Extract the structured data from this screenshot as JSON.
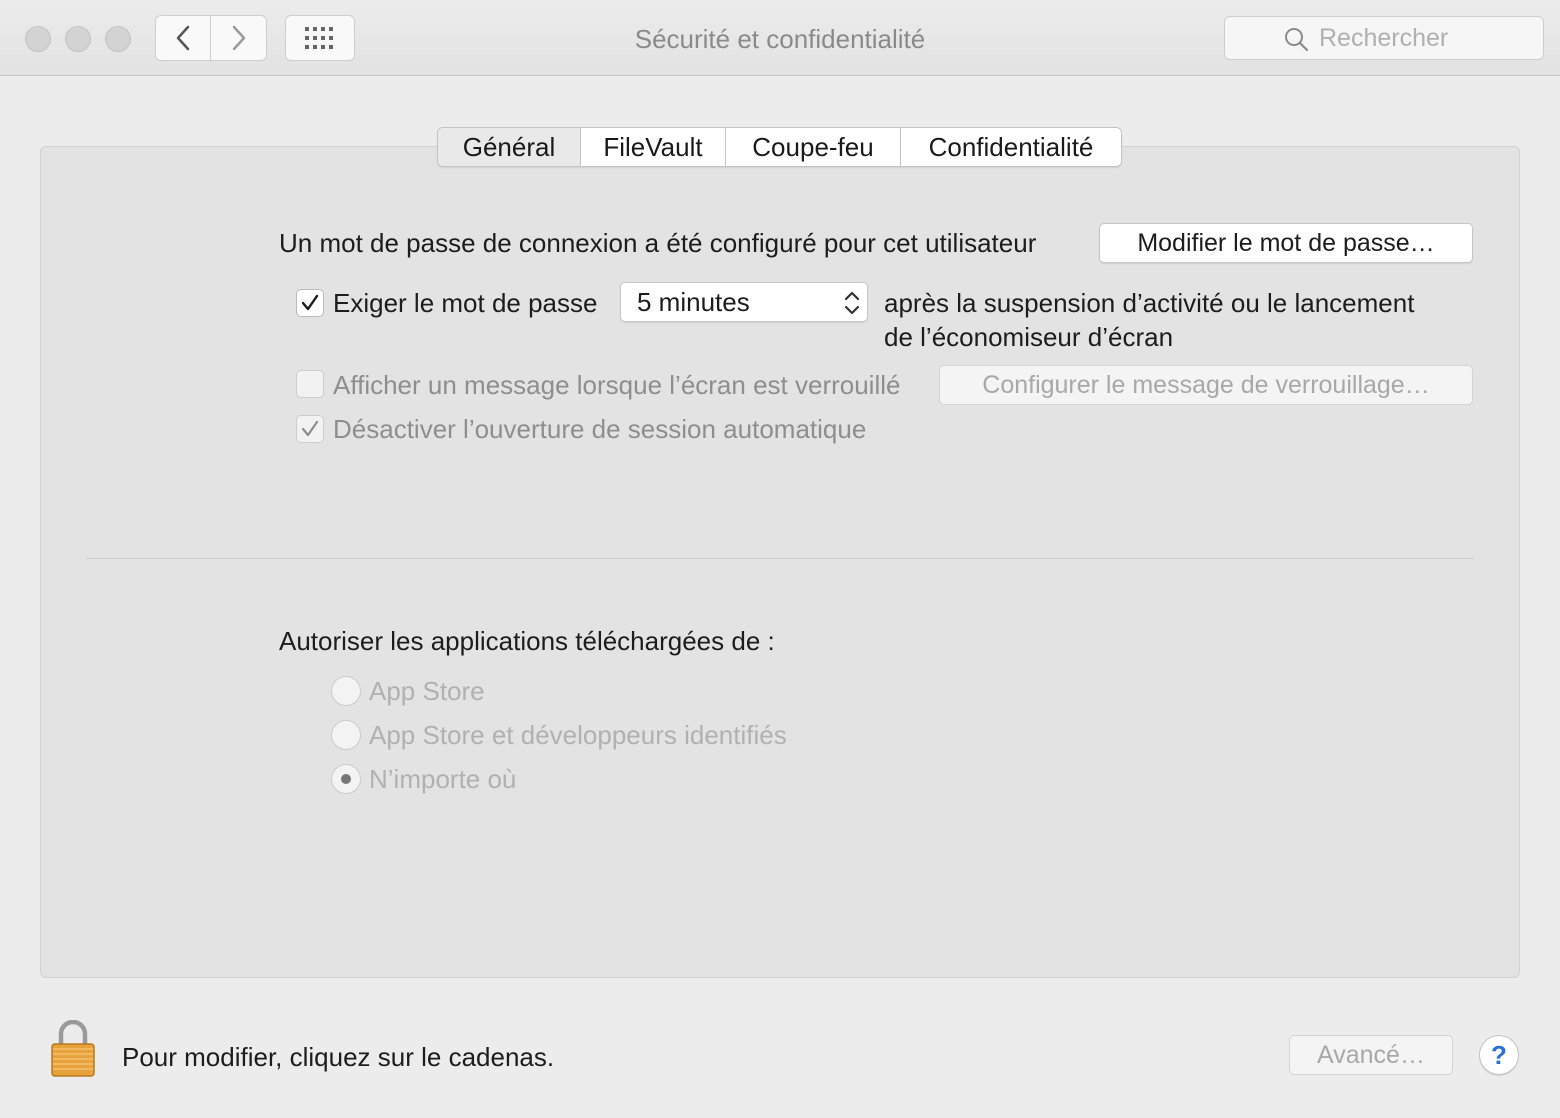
{
  "window": {
    "title": "Sécurité et confidentialité"
  },
  "search": {
    "placeholder": "Rechercher"
  },
  "tabs": [
    {
      "label": "Général",
      "active": true
    },
    {
      "label": "FileVault"
    },
    {
      "label": "Coupe-feu"
    },
    {
      "label": "Confidentialité"
    }
  ],
  "general": {
    "password_text": "Un mot de passe de connexion a été configuré pour cet utilisateur",
    "change_password_button": "Modifier le mot de passe…",
    "require_password": {
      "label": "Exiger le mot de passe",
      "checked": true,
      "delay_value": "5 minutes",
      "after_line1": "après la suspension d’activité ou le lancement",
      "after_line2": "de l’économiseur d’écran"
    },
    "show_message": {
      "label": "Afficher un message lorsque l’écran est verrouillé",
      "checked": false,
      "button": "Configurer le message de verrouillage…"
    },
    "disable_autologin": {
      "label": "Désactiver l’ouverture de session automatique",
      "checked": true
    },
    "allow_apps_label": "Autoriser les applications téléchargées de :",
    "allow_options": [
      {
        "label": "App Store",
        "selected": false
      },
      {
        "label": "App Store et développeurs identifiés",
        "selected": false
      },
      {
        "label": "N’importe où",
        "selected": true
      }
    ]
  },
  "footer": {
    "lock_text": "Pour modifier, cliquez sur le cadenas.",
    "advanced_button": "Avancé…",
    "help_label": "?"
  },
  "colors": {
    "accent": "#2b6fd6",
    "lock_gold": "#e8a33c"
  }
}
